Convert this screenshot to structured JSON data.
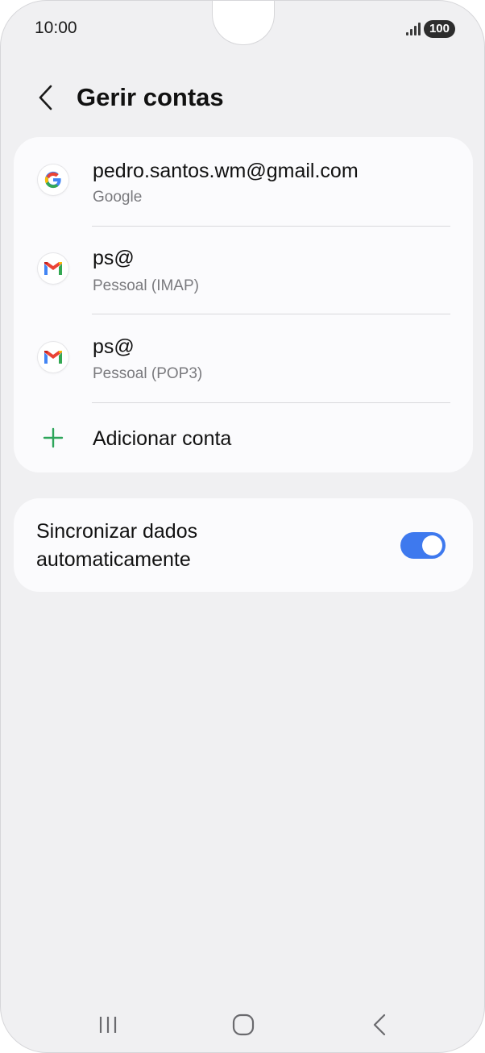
{
  "status_bar": {
    "time": "10:00",
    "battery": "100"
  },
  "header": {
    "title": "Gerir contas",
    "back_icon": "chevron-left-icon"
  },
  "accounts": [
    {
      "name": "pedro.santos.wm@gmail.com",
      "type": "Google",
      "icon": "google-icon"
    },
    {
      "name": "ps@",
      "type": "Pessoal (IMAP)",
      "icon": "gmail-icon"
    },
    {
      "name": "ps@",
      "type": "Pessoal (POP3)",
      "icon": "gmail-icon"
    }
  ],
  "add_account": {
    "label": "Adicionar conta",
    "icon": "plus-icon",
    "icon_color": "#2da55a"
  },
  "sync": {
    "label": "Sincronizar dados automaticamente",
    "enabled": true,
    "toggle_color": "#3e79ee"
  },
  "nav_bar": {
    "recents_icon": "recents-icon",
    "home_icon": "home-icon",
    "back_icon": "back-icon"
  }
}
